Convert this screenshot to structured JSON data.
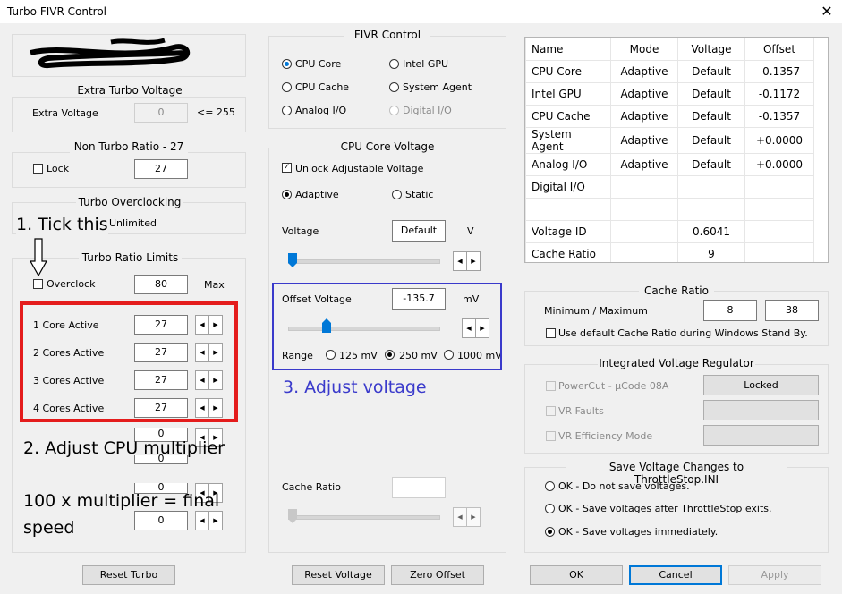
{
  "window": {
    "title": "Turbo FIVR Control",
    "close_glyph": "✕"
  },
  "extra_turbo": {
    "title": "Extra Turbo Voltage",
    "label": "Extra Voltage",
    "value": "0",
    "limit": "<= 255"
  },
  "non_turbo": {
    "title": "Non Turbo Ratio - 27",
    "lock_label": "Lock",
    "value": "27"
  },
  "turbo_oc": {
    "title": "Turbo Overclocking",
    "unlimited": "Unlimited"
  },
  "turbo_ratio": {
    "title": "Turbo Ratio Limits",
    "overclock_label": "Overclock",
    "max_value": "80",
    "max_label": "Max",
    "rows": [
      {
        "label": "1 Core Active",
        "value": "27"
      },
      {
        "label": "2 Cores Active",
        "value": "27"
      },
      {
        "label": "3 Cores Active",
        "value": "27"
      },
      {
        "label": "4 Cores Active",
        "value": "27"
      }
    ],
    "hidden_values": [
      "0",
      "0",
      "0",
      "0"
    ]
  },
  "fivr": {
    "title": "FIVR Control",
    "options": [
      "CPU Core",
      "Intel GPU",
      "CPU Cache",
      "System Agent",
      "Analog I/O",
      "Digital I/O"
    ]
  },
  "core_voltage": {
    "title": "CPU Core Voltage",
    "unlock_label": "Unlock Adjustable Voltage",
    "adaptive": "Adaptive",
    "static": "Static",
    "voltage_label": "Voltage",
    "voltage_value": "Default",
    "voltage_unit": "V",
    "offset_label": "Offset Voltage",
    "offset_value": "-135.7",
    "offset_unit": "mV",
    "range_label": "Range",
    "range_options": [
      "125 mV",
      "250 mV",
      "1000 mV"
    ],
    "cache_ratio_label": "Cache Ratio"
  },
  "table": {
    "headers": [
      "Name",
      "Mode",
      "Voltage",
      "Offset"
    ],
    "rows": [
      [
        "CPU Core",
        "Adaptive",
        "Default",
        "-0.1357"
      ],
      [
        "Intel GPU",
        "Adaptive",
        "Default",
        "-0.1172"
      ],
      [
        "CPU Cache",
        "Adaptive",
        "Default",
        "-0.1357"
      ],
      [
        "System Agent",
        "Adaptive",
        "Default",
        "+0.0000"
      ],
      [
        "Analog I/O",
        "Adaptive",
        "Default",
        "+0.0000"
      ],
      [
        "Digital I/O",
        "",
        "",
        ""
      ],
      [
        "",
        "",
        "",
        ""
      ],
      [
        "Voltage ID",
        "",
        "0.6041",
        ""
      ],
      [
        "Cache Ratio",
        "",
        "9",
        ""
      ]
    ]
  },
  "cache_ratio": {
    "title": "Cache Ratio",
    "minmax_label": "Minimum / Maximum",
    "min": "8",
    "max": "38",
    "default_label": "Use default Cache Ratio during Windows Stand By."
  },
  "ivr": {
    "title": "Integrated Voltage Regulator",
    "powercut": "PowerCut  -  µCode 08A",
    "locked": "Locked",
    "vr_faults": "VR Faults",
    "vr_eff": "VR Efficiency Mode"
  },
  "save": {
    "title": "Save Voltage Changes to ThrottleStop.INI",
    "options": [
      "OK - Do not save voltages.",
      "OK - Save voltages after ThrottleStop exits.",
      "OK - Save voltages immediately."
    ]
  },
  "buttons": {
    "reset_turbo": "Reset Turbo",
    "reset_voltage": "Reset Voltage",
    "zero_offset": "Zero Offset",
    "ok": "OK",
    "cancel": "Cancel",
    "apply": "Apply"
  },
  "annotations": {
    "tick": "1. Tick this",
    "adjust_mult": "2. Adjust CPU multiplier",
    "adjust_volt": "3. Adjust voltage",
    "formula_1": "100 x multiplier = final",
    "formula_2": "speed"
  },
  "colors": {
    "red_box": "#e41c1c",
    "blue_box": "#3a3acb",
    "blue_text": "#3a3acb",
    "focus": "#0078d7"
  }
}
